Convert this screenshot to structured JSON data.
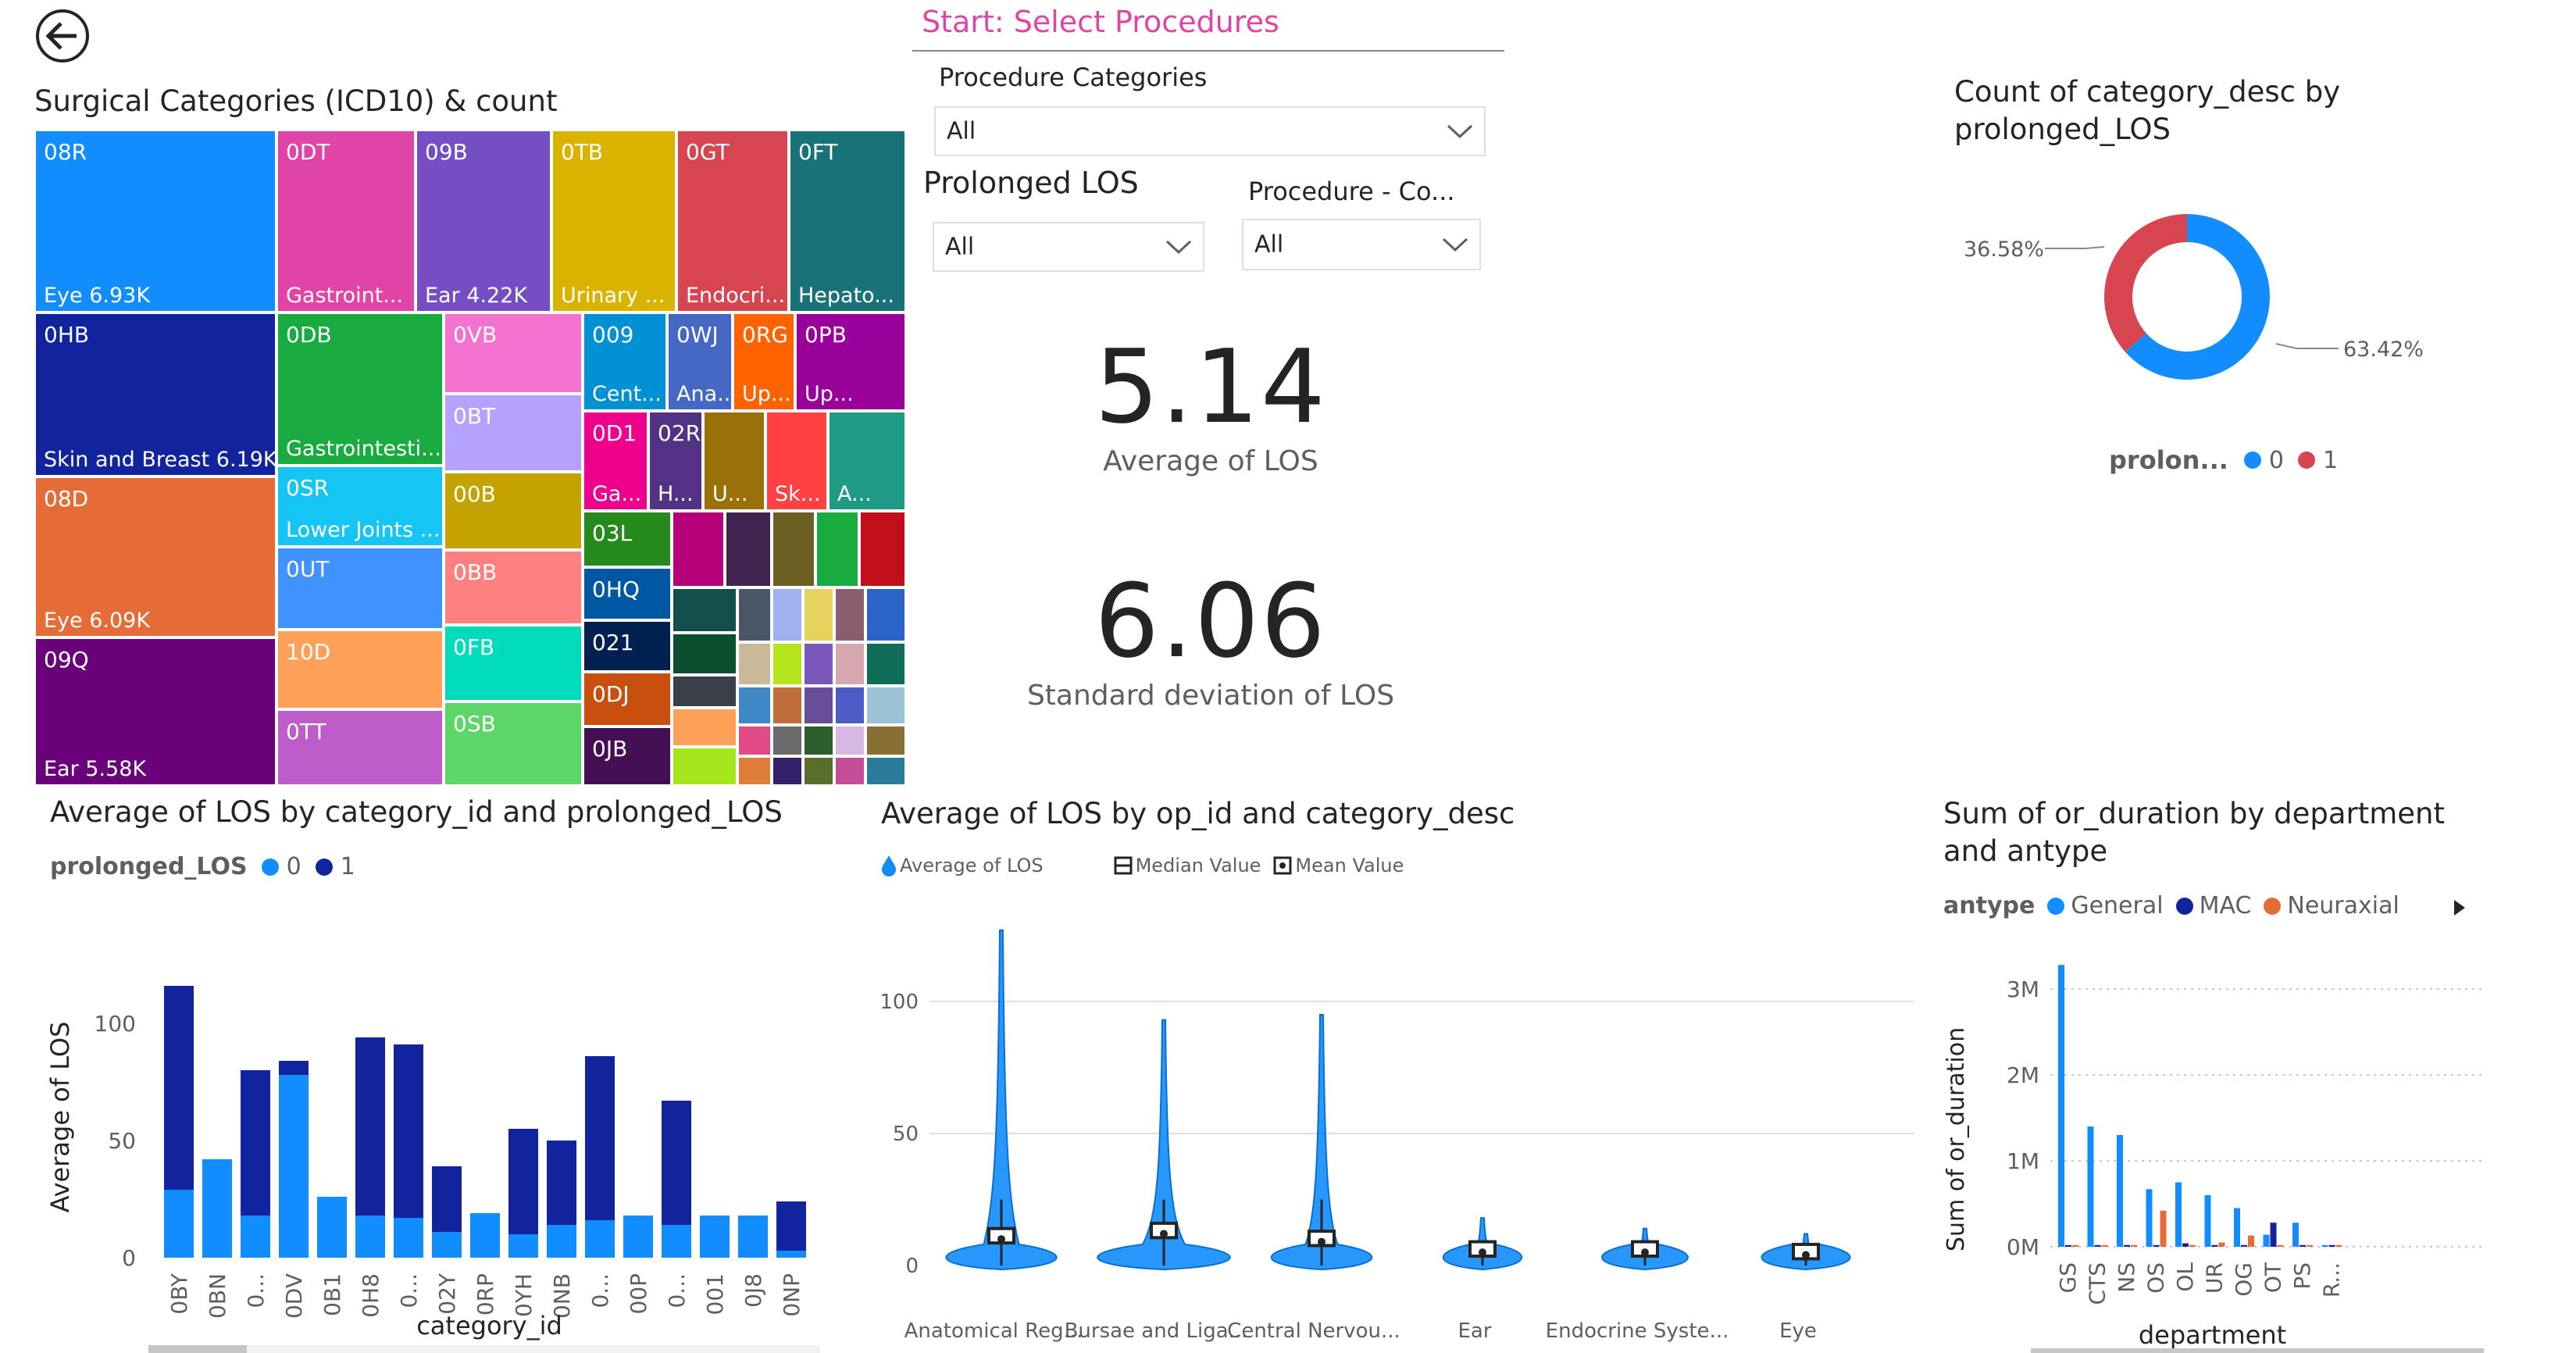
{
  "header": {
    "slicer_panel_title": "Start: Select Procedures"
  },
  "slicers": {
    "procedure_categories": {
      "label": "Procedure Categories",
      "value": "All"
    },
    "prolonged_los": {
      "label": "Prolonged LOS",
      "value": "All"
    },
    "procedure_co": {
      "label": "Procedure - Co...",
      "value": "All"
    }
  },
  "treemap": {
    "title": "Surgical Categories (ICD10) & count",
    "tiles": [
      {
        "code": "08R",
        "label": "Eye 6.93K",
        "color": "#118dff"
      },
      {
        "code": "0HB",
        "label": "Skin and Breast 6.19K",
        "color": "#12239e"
      },
      {
        "code": "08D",
        "label": "Eye 6.09K",
        "color": "#e66c37"
      },
      {
        "code": "09Q",
        "label": "Ear 5.58K",
        "color": "#6b007b"
      },
      {
        "code": "0DT",
        "label": "Gastroint...",
        "color": "#e044a7"
      },
      {
        "code": "09B",
        "label": "Ear 4.22K",
        "color": "#744ec2"
      },
      {
        "code": "0TB",
        "label": "Urinary ...",
        "color": "#d9b300"
      },
      {
        "code": "0GT",
        "label": "Endocri...",
        "color": "#d64550"
      },
      {
        "code": "0FT",
        "label": "Hepato...",
        "color": "#197278"
      },
      {
        "code": "0DB",
        "label": "Gastrointesti...",
        "color": "#1aab40"
      },
      {
        "code": "0SR",
        "label": "Lower Joints ...",
        "color": "#15c6f4"
      },
      {
        "code": "0UT",
        "label": "",
        "color": "#4092ff"
      },
      {
        "code": "10D",
        "label": "",
        "color": "#ffa058"
      },
      {
        "code": "0TT",
        "label": "",
        "color": "#be5dc9"
      },
      {
        "code": "0VB",
        "label": "",
        "color": "#f472d0"
      },
      {
        "code": "0BT",
        "label": "",
        "color": "#b5a1ff"
      },
      {
        "code": "00B",
        "label": "",
        "color": "#c4a200"
      },
      {
        "code": "0BB",
        "label": "",
        "color": "#ff8080"
      },
      {
        "code": "0FB",
        "label": "",
        "color": "#00dbbc"
      },
      {
        "code": "0SB",
        "label": "",
        "color": "#5bd667"
      },
      {
        "code": "009",
        "label": "Cent...",
        "color": "#0091d5"
      },
      {
        "code": "0WJ",
        "label": "Ana...",
        "color": "#4668c5"
      },
      {
        "code": "0RG",
        "label": "Up...",
        "color": "#ff6300"
      },
      {
        "code": "0PB",
        "label": "Up...",
        "color": "#99009a"
      },
      {
        "code": "0D1",
        "label": "Ga...",
        "color": "#ec008c"
      },
      {
        "code": "02R",
        "label": "H...",
        "color": "#533285"
      },
      {
        "code": "",
        "label": "U...",
        "color": "#99700a"
      },
      {
        "code": "",
        "label": "Sk...",
        "color": "#ff4141"
      },
      {
        "code": "",
        "label": "A...",
        "color": "#1f9a85"
      },
      {
        "code": "03L",
        "label": "",
        "color": "#25891c"
      },
      {
        "code": "0HQ",
        "label": "",
        "color": "#0057a2"
      },
      {
        "code": "021",
        "label": "",
        "color": "#002050"
      },
      {
        "code": "0DJ",
        "label": "",
        "color": "#c94f0f"
      },
      {
        "code": "0JB",
        "label": "",
        "color": "#450f54"
      }
    ]
  },
  "kpis": {
    "avg_los": {
      "value": "5.14",
      "label": "Average of LOS"
    },
    "std_los": {
      "value": "6.06",
      "label": "Standard deviation of LOS"
    }
  },
  "donut": {
    "title_line1": "Count of category_desc by",
    "title_line2": "prolonged_LOS",
    "legend_title": "prolon...",
    "legend": [
      {
        "name": "0",
        "color": "#118dff"
      },
      {
        "name": "1",
        "color": "#d64550"
      }
    ],
    "slices": [
      {
        "name": "0",
        "value": 63.42,
        "label": "63.42%",
        "color": "#118dff"
      },
      {
        "name": "1",
        "value": 36.58,
        "label": "36.58%",
        "color": "#d64550"
      }
    ]
  },
  "bar_los": {
    "title": "Average of LOS by category_id and prolonged_LOS",
    "legend_title": "prolonged_LOS",
    "legend": [
      {
        "name": "0",
        "color": "#118dff"
      },
      {
        "name": "1",
        "color": "#12239e"
      }
    ]
  },
  "violin": {
    "title": "Average of LOS by op_id and category_desc",
    "legend": [
      {
        "name": "Average of LOS",
        "icon": "drop-icon"
      },
      {
        "name": "Median Value",
        "icon": "median-icon"
      },
      {
        "name": "Mean Value",
        "icon": "mean-icon"
      }
    ]
  },
  "or_duration": {
    "title_line1": "Sum of or_duration by department",
    "title_line2": "and antype",
    "legend_title": "antype",
    "legend": [
      {
        "name": "General",
        "color": "#118dff"
      },
      {
        "name": "MAC",
        "color": "#12239e"
      },
      {
        "name": "Neuraxial",
        "color": "#e66c37"
      }
    ]
  },
  "chart_data": [
    {
      "type": "bar",
      "title": "Average of LOS by category_id and prolonged_LOS",
      "xlabel": "category_id",
      "ylabel": "Average of LOS",
      "ylim": [
        0,
        120
      ],
      "yticks": [
        0,
        50,
        100
      ],
      "stacked": true,
      "grid": false,
      "legend_position": "top-left",
      "categories": [
        "0BY",
        "0BN",
        "0...",
        "0DV",
        "0B1",
        "0H8",
        "0...",
        "02Y",
        "0RP",
        "0YH",
        "0NB",
        "0...",
        "00P",
        "0...",
        "001",
        "0J8",
        "0NP"
      ],
      "series": [
        {
          "name": "0",
          "color": "#118dff",
          "values": [
            29,
            42,
            18,
            78,
            26,
            18,
            17,
            11,
            19,
            10,
            14,
            16,
            18,
            14,
            18,
            18,
            3
          ]
        },
        {
          "name": "1",
          "color": "#12239e",
          "values": [
            87,
            0,
            62,
            6,
            0,
            76,
            74,
            28,
            0,
            45,
            36,
            70,
            0,
            53,
            0,
            0,
            21
          ]
        }
      ]
    },
    {
      "type": "violin",
      "title": "Average of LOS by op_id and category_desc",
      "ylim": [
        0,
        130
      ],
      "yticks": [
        0,
        50,
        100
      ],
      "categories": [
        "Anatomical Reg...",
        "Bursae and Liga...",
        "Central Nervou...",
        "Ear",
        "Endocrine Syste...",
        "Eye"
      ],
      "max": [
        127,
        93,
        95,
        18,
        14,
        12
      ],
      "median": [
        7,
        9,
        6,
        2,
        3,
        1
      ],
      "mean": [
        8,
        10,
        7,
        3,
        3,
        2
      ]
    },
    {
      "type": "bar",
      "title": "Sum of or_duration by department and antype",
      "xlabel": "department",
      "ylabel": "Sum of or_duration",
      "ylim": [
        0,
        3300000
      ],
      "yticks": [
        0,
        1000000,
        2000000,
        3000000
      ],
      "ytick_labels": [
        "0M",
        "1M",
        "2M",
        "3M"
      ],
      "grid": true,
      "legend_position": "top-left",
      "categories": [
        "GS",
        "CTS",
        "NS",
        "OS",
        "OL",
        "UR",
        "OG",
        "OT",
        "PS",
        "R..."
      ],
      "series": [
        {
          "name": "General",
          "color": "#118dff",
          "values": [
            3280000,
            1400000,
            1300000,
            670000,
            750000,
            600000,
            450000,
            140000,
            280000,
            20000
          ]
        },
        {
          "name": "MAC",
          "color": "#12239e",
          "values": [
            20000,
            20000,
            20000,
            20000,
            40000,
            20000,
            20000,
            280000,
            20000,
            20000
          ]
        },
        {
          "name": "Neuraxial",
          "color": "#e66c37",
          "values": [
            20000,
            20000,
            20000,
            420000,
            20000,
            50000,
            130000,
            20000,
            20000,
            20000
          ]
        }
      ]
    }
  ]
}
